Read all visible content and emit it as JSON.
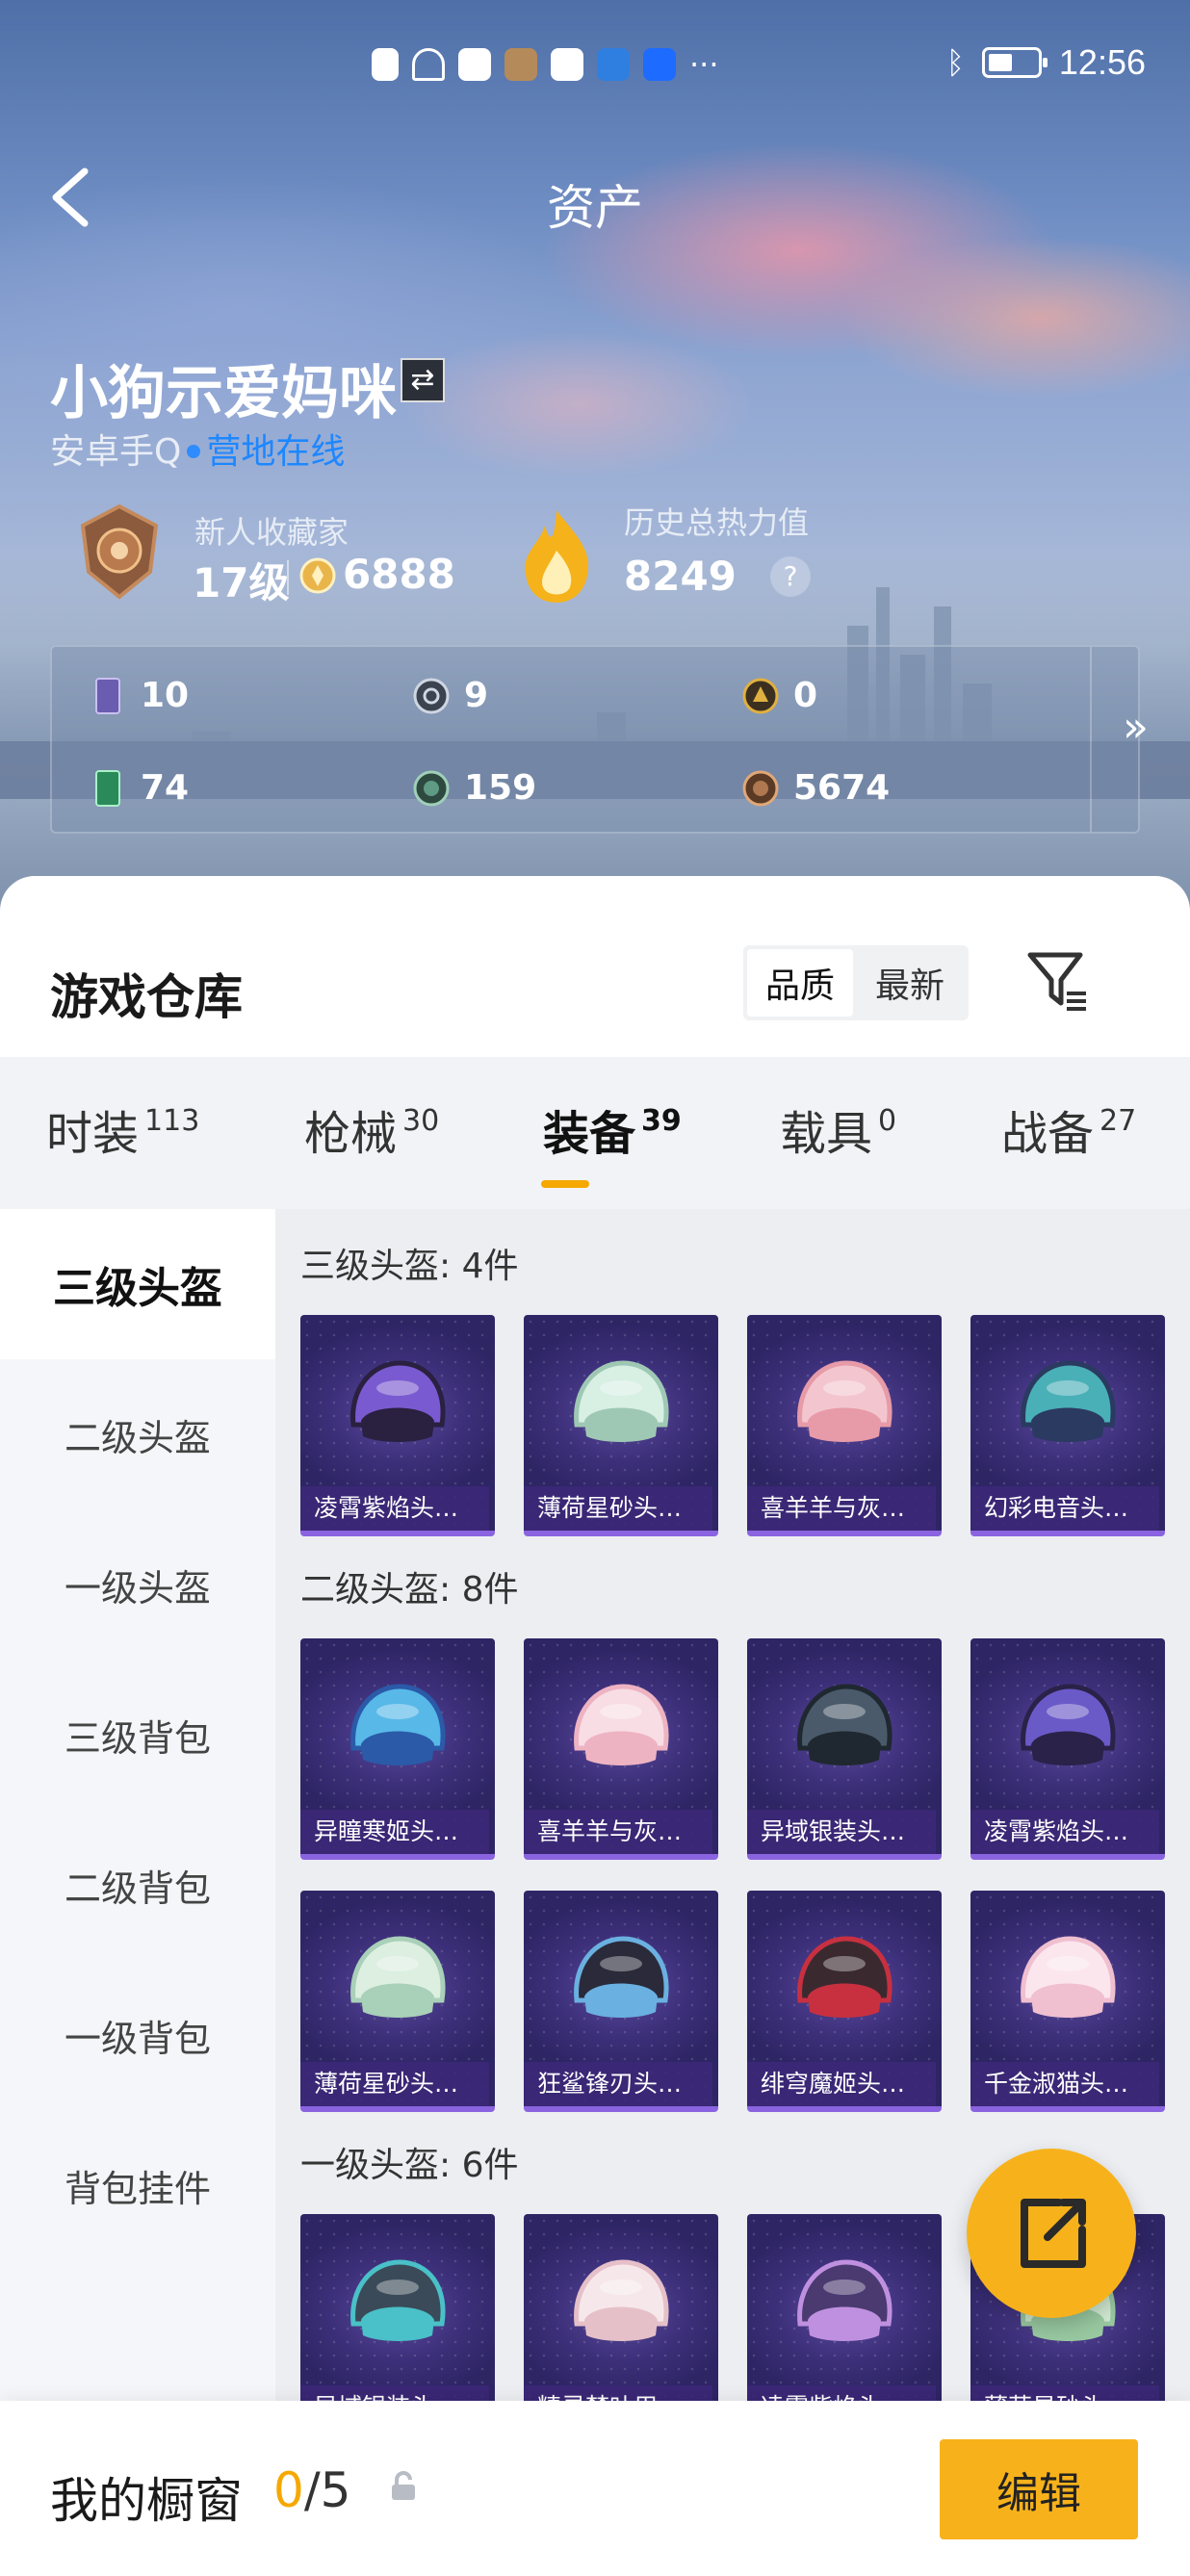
{
  "status_bar": {
    "time": "12:56"
  },
  "header": {
    "title": "资产"
  },
  "player": {
    "name": "小狗示爱妈咪",
    "platform": "安卓手Q",
    "online_status": "营地在线",
    "collector_label": "新人收藏家",
    "level": "17级",
    "coins": "6888",
    "heat_label": "历史总热力值",
    "heat_value": "8249"
  },
  "stats": [
    "10",
    "9",
    "0",
    "74",
    "159",
    "5674"
  ],
  "warehouse": {
    "title": "游戏仓库",
    "sort_options": [
      "品质",
      "最新"
    ],
    "tabs": [
      {
        "label": "时装",
        "count": "113"
      },
      {
        "label": "枪械",
        "count": "30"
      },
      {
        "label": "装备",
        "count": "39"
      },
      {
        "label": "载具",
        "count": "0"
      },
      {
        "label": "战备",
        "count": "27"
      }
    ],
    "side_categories": [
      "三级头盔",
      "二级头盔",
      "一级头盔",
      "三级背包",
      "二级背包",
      "一级背包",
      "背包挂件"
    ],
    "groups": [
      {
        "title": "三级头盔: 4件",
        "items": [
          "凌霄紫焰头…",
          "薄荷星砂头…",
          "喜羊羊与灰…",
          "幻彩电音头…"
        ]
      },
      {
        "title": "二级头盔: 8件",
        "items": [
          "异瞳寒姬头…",
          "喜羊羊与灰…",
          "异域银装头…",
          "凌霄紫焰头…",
          "薄荷星砂头…",
          "狂鲨锋刃头…",
          "绯穹魔姬头…",
          "千金淑猫头…"
        ]
      },
      {
        "title": "一级头盔: 6件",
        "items": [
          "异域银装头…",
          "精灵梦叶用…",
          "凌霄紫焰头…",
          "薄荷星砂头…"
        ]
      }
    ]
  },
  "showcase": {
    "title": "我的橱窗",
    "current": "0",
    "total": "/5",
    "edit_label": "编辑"
  },
  "colors": {
    "accent": "#f5a800",
    "online": "#1e87ff",
    "card": "#3c2f79"
  },
  "icons": [
    "back-icon",
    "switch-icon",
    "medal-icon",
    "coin-icon",
    "flame-icon",
    "help-icon",
    "filter-icon",
    "share-icon",
    "lock-icon"
  ]
}
